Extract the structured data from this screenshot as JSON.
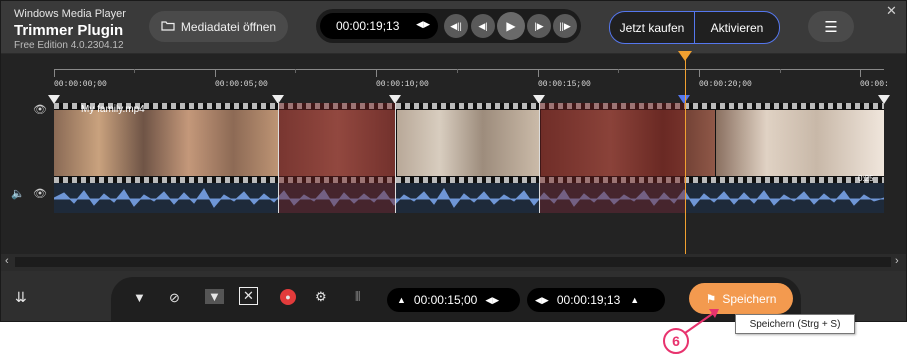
{
  "app": {
    "line1": "Windows Media Player",
    "title": "Trimmer Plugin",
    "edition": "Free Edition 4.0.2304.12"
  },
  "toolbar": {
    "open_label": "Mediadatei öffnen",
    "current_time": "00:00:19;13",
    "buy_label": "Jetzt kaufen",
    "activate_label": "Aktivieren"
  },
  "ruler": {
    "labels": [
      "00:00:00;00",
      "00:00:05;00",
      "00:00:10;00",
      "00:00:15;00",
      "00:00:20;00",
      "00:00:"
    ]
  },
  "clip": {
    "name": "My family.mp4",
    "end_label": "0:25"
  },
  "bottom": {
    "start_time": "00:00:15;00",
    "end_time": "00:00:19;13",
    "save_label": "Speichern",
    "tooltip": "Speichern (Strg + S)",
    "callout_number": "6"
  },
  "colors": {
    "accent": "#f39a4f",
    "playhead": "#f0a030",
    "activate_border": "#5577ee",
    "callout": "#e8336e",
    "waveform": "#6f96d6"
  }
}
